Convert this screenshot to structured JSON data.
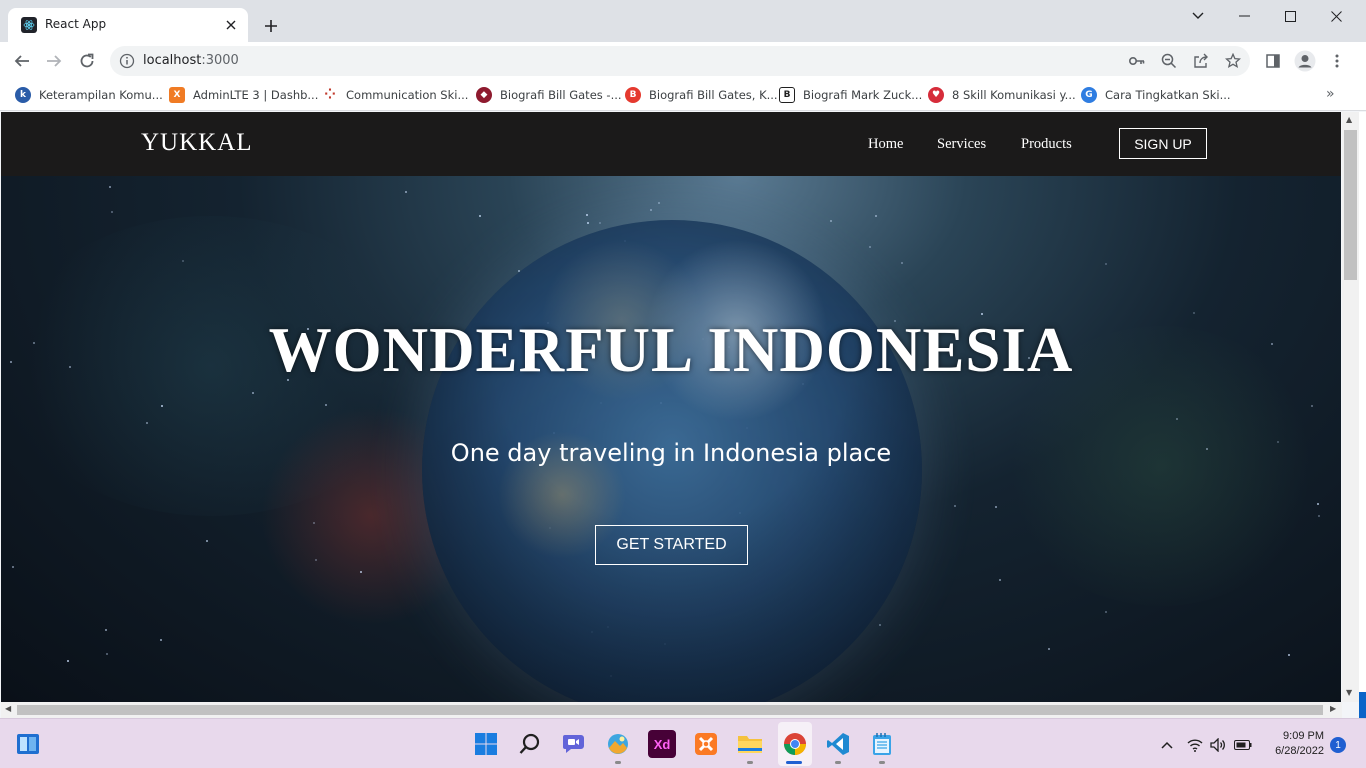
{
  "browser": {
    "tab_title": "React App",
    "url_host": "localhost",
    "url_port": ":3000"
  },
  "bookmarks": [
    {
      "label": "Keterampilan Komu...",
      "icon": "k-icon",
      "color": "#2a5ca8",
      "glyph": "k"
    },
    {
      "label": "AdminLTE 3 | Dashb...",
      "icon": "xampp-icon",
      "color": "#f07b24",
      "glyph": "X"
    },
    {
      "label": "Communication Ski...",
      "icon": "grid-dots-icon",
      "color": "#c0392b",
      "glyph": "⁘"
    },
    {
      "label": "Biografi Bill Gates -...",
      "icon": "diamond-icon",
      "color": "#8e1a2e",
      "glyph": "◆"
    },
    {
      "label": "Biografi Bill Gates, K...",
      "icon": "b-red-icon",
      "color": "#e53a2f",
      "glyph": "B"
    },
    {
      "label": "Biografi Mark Zuck...",
      "icon": "b-black-icon",
      "color": "#202020",
      "glyph": "B"
    },
    {
      "label": "8 Skill Komunikasi y...",
      "icon": "heart-icon",
      "color": "#d62c3a",
      "glyph": "♥"
    },
    {
      "label": "Cara Tingkatkan Ski...",
      "icon": "g-blue-icon",
      "color": "#2f7de1",
      "glyph": "G"
    }
  ],
  "site": {
    "logo": "YUKKAL",
    "nav": {
      "home": "Home",
      "services": "Services",
      "products": "Products"
    },
    "signup": "SIGN UP",
    "hero_title": "WONDERFUL INDONESIA",
    "hero_subtitle": "One day traveling in Indonesia place",
    "cta": "GET STARTED"
  },
  "taskbar": {
    "apps": [
      "windows-start-icon",
      "search-icon",
      "teams-chat-icon",
      "photos-icon",
      "adobe-xd-icon",
      "xampp-icon",
      "chrome-icon",
      "vscode-icon",
      "notepad-icon"
    ],
    "xd_label": "Xd",
    "time": "9:09 PM",
    "date": "6/28/2022",
    "notifications": "1"
  }
}
